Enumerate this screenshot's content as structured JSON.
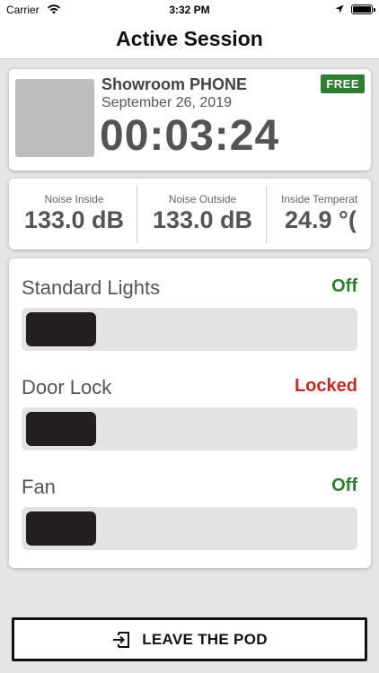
{
  "status_bar": {
    "carrier": "Carrier",
    "time": "3:32 PM",
    "icons": [
      "wifi-icon",
      "location-arrow-icon",
      "battery-icon"
    ]
  },
  "nav": {
    "title": "Active Session"
  },
  "session": {
    "pod_name": "Showroom PHONE",
    "date": "September 26, 2019",
    "timer": "00:03:24",
    "badge": "FREE",
    "badge_color": "#2e7d32"
  },
  "metrics": [
    {
      "label": "Noise Inside",
      "value": "133.0 dB"
    },
    {
      "label": "Noise Outside",
      "value": "133.0 dB"
    },
    {
      "label": "Inside Temperat",
      "value": "24.9 °("
    }
  ],
  "controls": [
    {
      "label": "Standard Lights",
      "state": "Off",
      "state_color": "#2e7d32"
    },
    {
      "label": "Door Lock",
      "state": "Locked",
      "state_color": "#c62828"
    },
    {
      "label": "Fan",
      "state": "Off",
      "state_color": "#2e7d32"
    }
  ],
  "leave": {
    "label": "LEAVE THE POD",
    "icon": "exit-icon"
  }
}
